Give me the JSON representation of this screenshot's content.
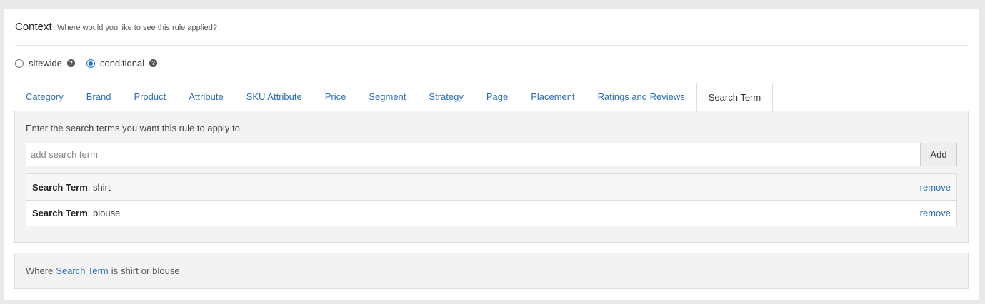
{
  "header": {
    "title": "Context",
    "subtitle": "Where would you like to see this rule applied?"
  },
  "scope": {
    "options": [
      {
        "label": "sitewide",
        "checked": false
      },
      {
        "label": "conditional",
        "checked": true
      }
    ],
    "help_glyph": "?"
  },
  "tabs": [
    {
      "label": "Category"
    },
    {
      "label": "Brand"
    },
    {
      "label": "Product"
    },
    {
      "label": "Attribute"
    },
    {
      "label": "SKU Attribute"
    },
    {
      "label": "Price"
    },
    {
      "label": "Segment"
    },
    {
      "label": "Strategy"
    },
    {
      "label": "Page"
    },
    {
      "label": "Placement"
    },
    {
      "label": "Ratings and Reviews"
    },
    {
      "label": "Search Term"
    }
  ],
  "active_tab": "Search Term",
  "search": {
    "instruction": "Enter the search terms you want this rule to apply to",
    "placeholder": "add search term",
    "value": "",
    "add_label": "Add"
  },
  "terms": [
    {
      "key": "Search Term",
      "sep": ": ",
      "value": "shirt",
      "action": "remove"
    },
    {
      "key": "Search Term",
      "sep": ": ",
      "value": "blouse",
      "action": "remove"
    }
  ],
  "summary": {
    "prefix": "Where",
    "field": "Search Term",
    "is": "is",
    "value1": "shirt",
    "or": "or",
    "value2": "blouse"
  },
  "colors": {
    "accent": "#2a6ebb",
    "radio": "#1a73e8"
  }
}
